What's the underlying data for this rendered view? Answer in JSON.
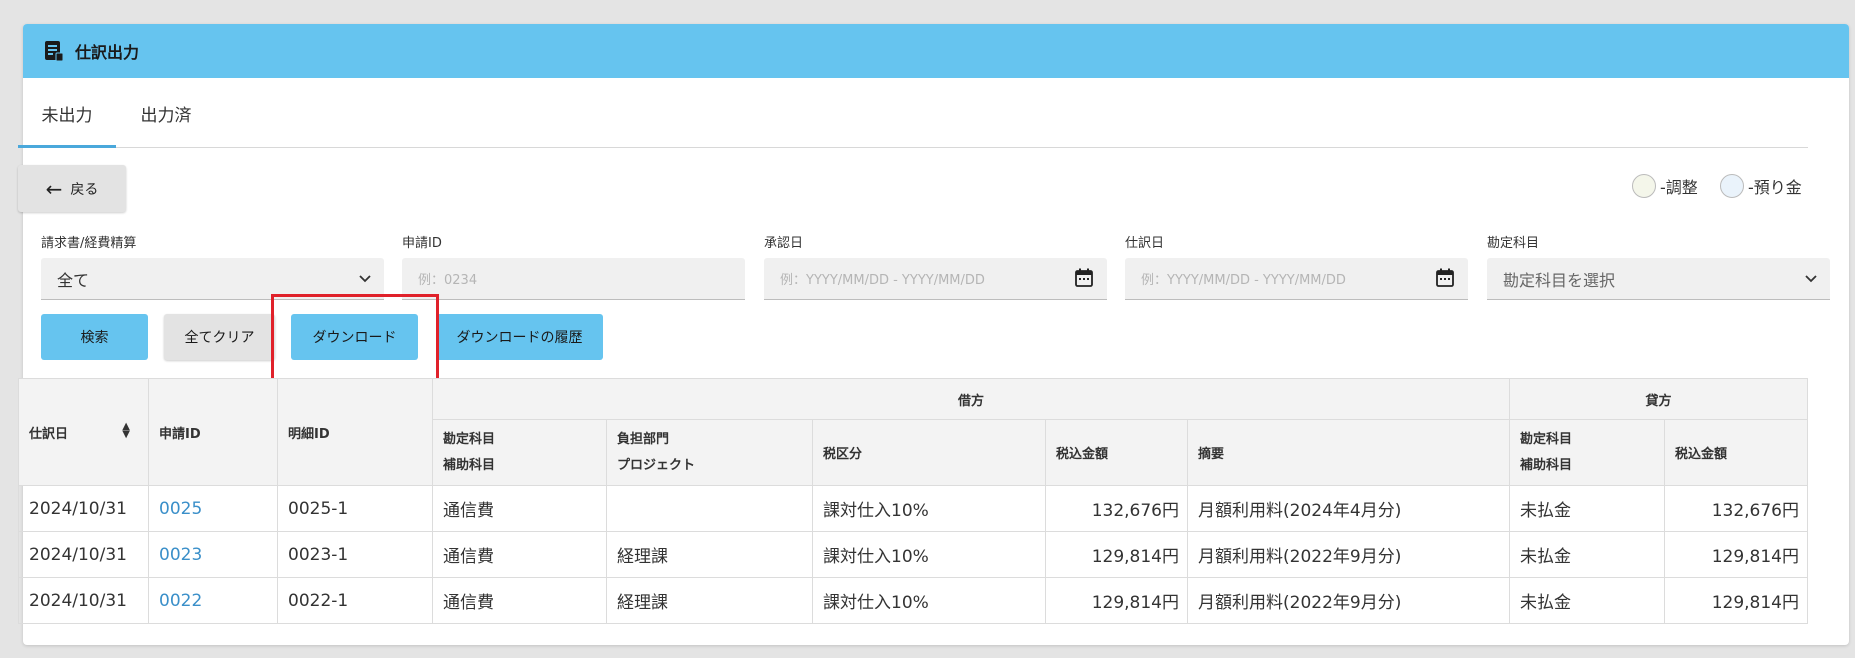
{
  "header": {
    "title": "仕訳出力",
    "icon": "document-list-icon"
  },
  "tabs": [
    {
      "label": "未出力",
      "active": true
    },
    {
      "label": "出力済",
      "active": false
    }
  ],
  "back_button": {
    "label": "戻る"
  },
  "legend": [
    {
      "label": "-調整",
      "color": "#f4f6ea"
    },
    {
      "label": "-預り金",
      "color": "#eaf3fb"
    }
  ],
  "filters": {
    "type": {
      "label": "請求書/経費精算",
      "value": "全て"
    },
    "application_id": {
      "label": "申請ID",
      "placeholder": "例：0234"
    },
    "approval_date": {
      "label": "承認日",
      "placeholder": "例：YYYY/MM/DD - YYYY/MM/DD"
    },
    "journal_date": {
      "label": "仕訳日",
      "placeholder": "例：YYYY/MM/DD - YYYY/MM/DD"
    },
    "account": {
      "label": "勘定科目",
      "placeholder": "勘定科目を選択"
    }
  },
  "buttons": {
    "search": "検索",
    "clear": "全てクリア",
    "download": "ダウンロード",
    "download_history": "ダウンロードの履歴"
  },
  "table": {
    "group_headers": {
      "debit": "借方",
      "credit": "貸方"
    },
    "headers": {
      "journal_date": "仕訳日",
      "application_id": "申請ID",
      "detail_id": "明細ID",
      "debit_account": "勘定科目",
      "debit_sub_account": "補助科目",
      "department": "負担部門",
      "project": "プロジェクト",
      "tax_category": "税区分",
      "debit_amount": "税込金額",
      "description": "摘要",
      "credit_account": "勘定科目",
      "credit_sub_account": "補助科目",
      "credit_amount": "税込金額"
    },
    "rows": [
      {
        "journal_date": "2024/10/31",
        "application_id": "0025",
        "detail_id": "0025-1",
        "debit_account": "通信費",
        "department": "",
        "tax_category": "課対仕入10%",
        "debit_amount": "132,676円",
        "description": "月額利用料(2024年4月分)",
        "credit_account": "未払金",
        "credit_amount": "132,676円"
      },
      {
        "journal_date": "2024/10/31",
        "application_id": "0023",
        "detail_id": "0023-1",
        "debit_account": "通信費",
        "department": "経理課",
        "tax_category": "課対仕入10%",
        "debit_amount": "129,814円",
        "description": "月額利用料(2022年9月分)",
        "credit_account": "未払金",
        "credit_amount": "129,814円"
      },
      {
        "journal_date": "2024/10/31",
        "application_id": "0022",
        "detail_id": "0022-1",
        "debit_account": "通信費",
        "department": "経理課",
        "tax_category": "課対仕入10%",
        "debit_amount": "129,814円",
        "description": "月額利用料(2022年9月分)",
        "credit_account": "未払金",
        "credit_amount": "129,814円"
      }
    ]
  },
  "colors": {
    "header": "#66c4ef",
    "accent": "#66c4ef",
    "link": "#3a8fc9",
    "highlight": "#e0212a"
  }
}
